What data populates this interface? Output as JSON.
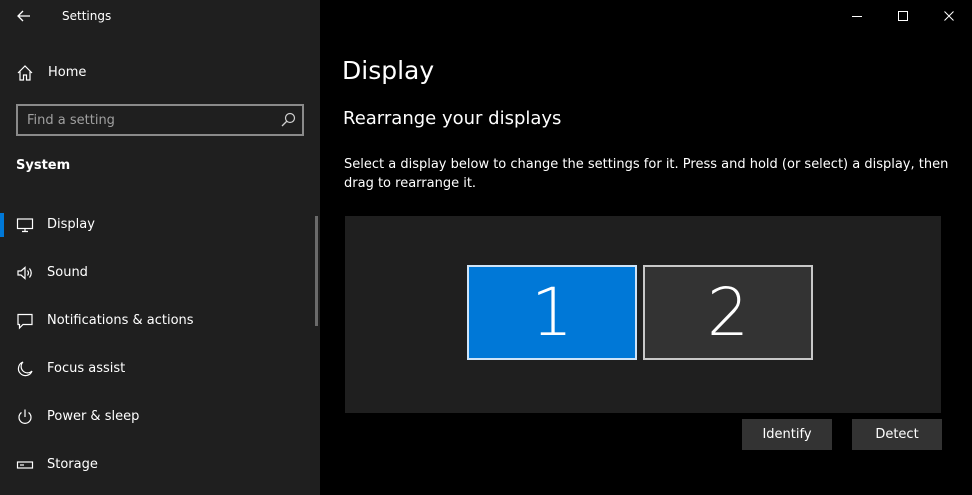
{
  "window": {
    "app_title": "Settings",
    "controls": [
      "minimize",
      "maximize",
      "close"
    ]
  },
  "sidebar": {
    "home_label": "Home",
    "search": {
      "placeholder": "Find a setting",
      "value": ""
    },
    "section_title": "System",
    "items": [
      {
        "label": "Display",
        "icon": "monitor-icon",
        "selected": true
      },
      {
        "label": "Sound",
        "icon": "speaker-icon",
        "selected": false
      },
      {
        "label": "Notifications & actions",
        "icon": "message-icon",
        "selected": false
      },
      {
        "label": "Focus assist",
        "icon": "moon-icon",
        "selected": false
      },
      {
        "label": "Power & sleep",
        "icon": "power-icon",
        "selected": false
      },
      {
        "label": "Storage",
        "icon": "storage-icon",
        "selected": false
      }
    ]
  },
  "main": {
    "title": "Display",
    "subtitle": "Rearrange your displays",
    "description": "Select a display below to change the settings for it. Press and hold (or select) a display, then drag to rearrange it.",
    "displays": [
      {
        "number": "1",
        "selected": true
      },
      {
        "number": "2",
        "selected": false
      }
    ],
    "buttons": {
      "identify": "Identify",
      "detect": "Detect"
    }
  },
  "colors": {
    "accent": "#0078d7",
    "sidebar_bg": "#1f1f1f",
    "main_bg": "#000000",
    "button_bg": "#333333"
  }
}
